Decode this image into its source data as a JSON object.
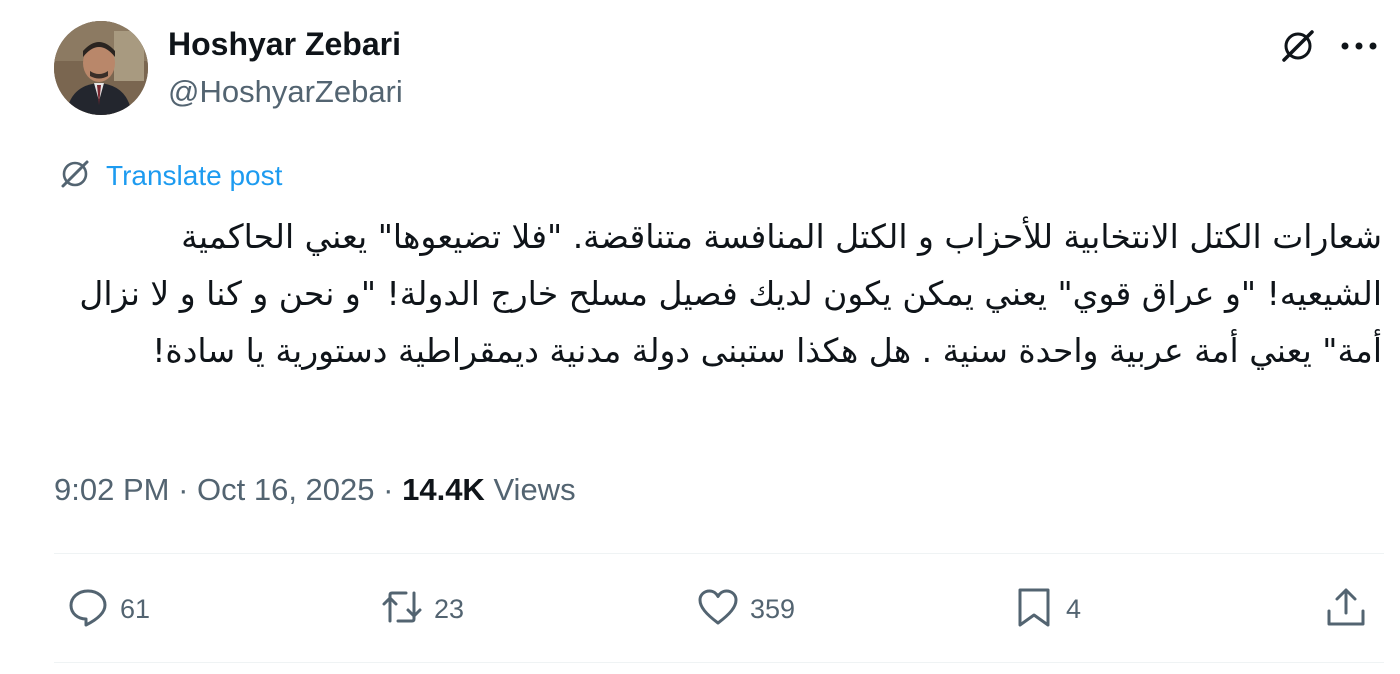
{
  "author": {
    "name": "Hoshyar Zebari",
    "handle": "@HoshyarZebari"
  },
  "header_icons": [
    "grok-icon",
    "more-icon"
  ],
  "translate": {
    "label": "Translate post",
    "icon": "globe-slash-icon"
  },
  "tweet": {
    "text": "شعارات الكتل الانتخابية للأحزاب و الكتل المنافسة متناقضة. \"فلا تضيعوها\" يعني الحاكمية الشيعيه! \"و عراق قوي\" يعني يمكن يكون لديك فصيل مسلح خارج الدولة! \"و نحن و كنا و لا نزال أمة\" يعني أمة عربية واحدة سنية . هل هكذا ستبنى دولة مدنية ديمقراطية دستورية يا سادة!"
  },
  "meta": {
    "time": "9:02 PM",
    "sep1": " · ",
    "date": "Oct 16, 2025",
    "sep2": " · ",
    "views_count": "14.4K",
    "views_label": " Views"
  },
  "actions": {
    "replies": "61",
    "reposts": "23",
    "likes": "359",
    "bookmarks": "4"
  },
  "colors": {
    "text": "#0f1419",
    "secondary": "#536471",
    "link": "#1d9bf0",
    "divider": "#eff3f4"
  }
}
